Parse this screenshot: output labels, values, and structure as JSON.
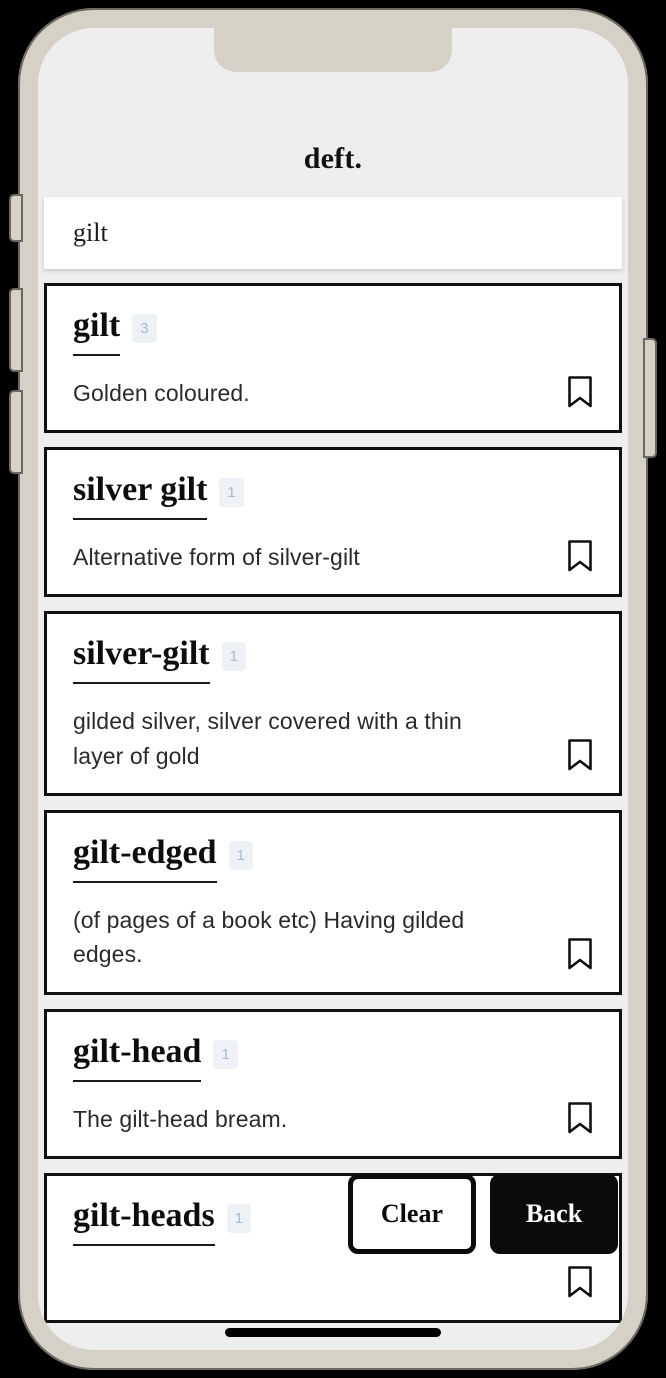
{
  "app": {
    "title": "deft."
  },
  "search": {
    "value": "gilt",
    "placeholder": "Search"
  },
  "results": [
    {
      "word": "gilt",
      "count": "3",
      "definition": "Golden coloured.",
      "bookmark_icon": "bookmark-icon"
    },
    {
      "word": "silver gilt",
      "count": "1",
      "definition": "Alternative form of silver-gilt",
      "bookmark_icon": "bookmark-icon"
    },
    {
      "word": "silver-gilt",
      "count": "1",
      "definition": "gilded silver, silver covered with a thin layer of gold",
      "bookmark_icon": "bookmark-icon"
    },
    {
      "word": "gilt-edged",
      "count": "1",
      "definition": "(of pages of a book etc) Having gilded edges.",
      "bookmark_icon": "bookmark-icon"
    },
    {
      "word": "gilt-head",
      "count": "1",
      "definition": "The gilt-head bream.",
      "bookmark_icon": "bookmark-icon"
    },
    {
      "word": "gilt-heads",
      "count": "1",
      "definition": "",
      "bookmark_icon": "bookmark-icon"
    }
  ],
  "actions": {
    "clear_label": "Clear",
    "back_label": "Back"
  },
  "colors": {
    "frame": "#d6d1c6",
    "screen_bg": "#efeeee",
    "card_border": "#101010",
    "badge_bg": "#eef1f6",
    "badge_text": "#a9bacd",
    "accent_black": "#0b0b0b"
  }
}
